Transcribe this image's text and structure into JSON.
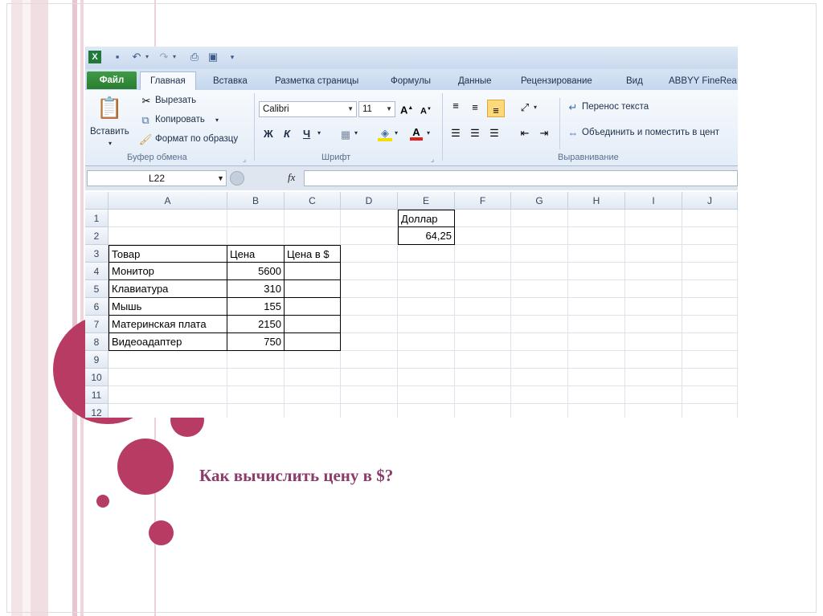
{
  "quick_access": {
    "icons": [
      "excel-app-icon",
      "save-icon",
      "undo-icon",
      "redo-icon",
      "print-preview-icon",
      "quick-print-icon",
      "customize-qat-icon"
    ]
  },
  "tabs": [
    "Файл",
    "Главная",
    "Вставка",
    "Разметка страницы",
    "Формулы",
    "Данные",
    "Рецензирование",
    "Вид",
    "ABBYY FineRea"
  ],
  "ribbon": {
    "clipboard": {
      "paste": "Вставить",
      "cut": "Вырезать",
      "copy": "Копировать",
      "format_painter": "Формат по образцу",
      "group_label": "Буфер обмена"
    },
    "font": {
      "font_name": "Calibri",
      "font_size": "11",
      "bold": "Ж",
      "italic": "К",
      "underline": "Ч",
      "group_label": "Шрифт"
    },
    "alignment": {
      "wrap_text": "Перенос текста",
      "merge_center": "Объединить и поместить в цент",
      "group_label": "Выравнивание"
    }
  },
  "formula_bar": {
    "name_box": "L22",
    "fx": "fx",
    "formula": ""
  },
  "grid": {
    "columns": [
      "A",
      "B",
      "C",
      "D",
      "E",
      "F",
      "G",
      "H",
      "I",
      "J"
    ],
    "rows": [
      "1",
      "2",
      "3",
      "4",
      "5",
      "6",
      "7",
      "8",
      "9",
      "10",
      "11",
      "12"
    ],
    "cells": {
      "E1": "Доллар",
      "E2": "64,25",
      "A3": "Товар",
      "B3": "Цена",
      "C3": "Цена в $",
      "A4": "Монитор",
      "B4": "5600",
      "A5": "Клавиатура",
      "B5": "310",
      "A6": "Мышь",
      "B6": "155",
      "A7": "Материнская плата",
      "B7": "2150",
      "A8": "Видеоадаптер",
      "B8": "750"
    }
  },
  "question": "Как вычислить цену в  $?",
  "colors": {
    "accent": "#b83b63",
    "question_text": "#8c3c6a",
    "file_tab": "#2a7d31"
  }
}
